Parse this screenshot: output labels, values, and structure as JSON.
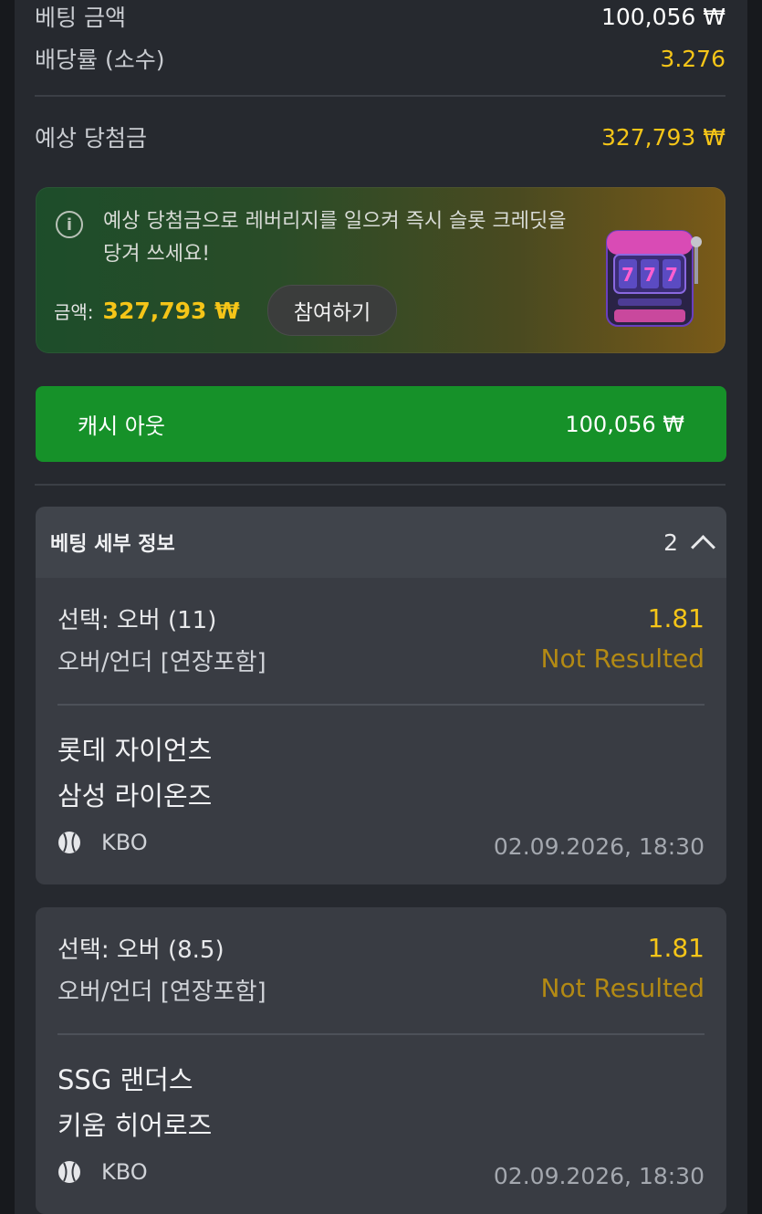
{
  "summary": {
    "stake_label": "베팅 금액",
    "stake_value": "100,056 ₩",
    "odds_label": "배당률 (소수)",
    "odds_value": "3.276",
    "payout_label": "예상 당첨금",
    "payout_value": "327,793 ₩"
  },
  "promo": {
    "message": "예상 당첨금으로 레버리지를 일으켜 즉시 슬롯 크레딧을 당겨 쓰세요!",
    "amount_label": "금액:",
    "amount_value": "327,793 ₩",
    "join_label": "참여하기",
    "slot_digits": "777"
  },
  "cashout": {
    "label": "캐시 아웃",
    "value": "100,056 ₩"
  },
  "details": {
    "title": "베팅 세부 정보",
    "count": "2"
  },
  "bets": [
    {
      "selection": "선택: 오버 (11)",
      "odds": "1.81",
      "market": "오버/언더 [연장포함]",
      "status": "Not Resulted",
      "team1": "롯데 자이언츠",
      "team2": "삼성 라이온즈",
      "sport_icon": "baseball-icon",
      "league": "KBO",
      "datetime": "02.09.2026, 18:30"
    },
    {
      "selection": "선택: 오버 (8.5)",
      "odds": "1.81",
      "market": "오버/언더 [연장포함]",
      "status": "Not Resulted",
      "team1": "SSG 랜더스",
      "team2": "키움 히어로즈",
      "sport_icon": "baseball-icon",
      "league": "KBO",
      "datetime": "02.09.2026, 18:30"
    }
  ],
  "colors": {
    "accent_gold": "#f5c518",
    "cashout_green": "#169129",
    "status_gold": "#b38a14"
  }
}
